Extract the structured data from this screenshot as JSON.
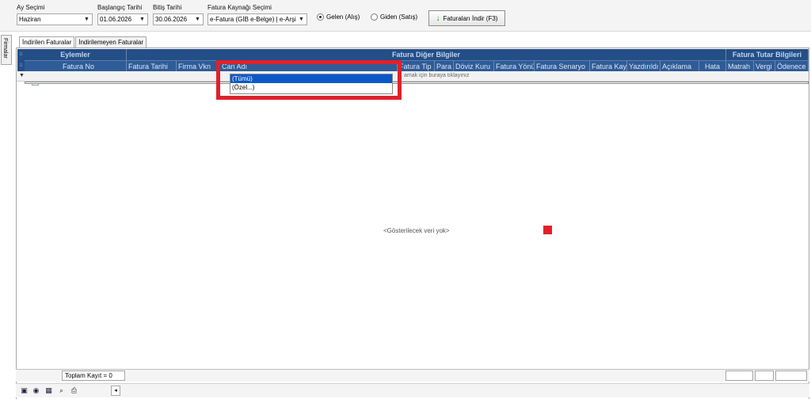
{
  "toolbar": {
    "month": {
      "label": "Ay Seçimi",
      "value": "Haziran"
    },
    "start": {
      "label": "Başlangıç Tarihi",
      "value": "01.06.2026"
    },
    "end": {
      "label": "Bitiş Tarihi",
      "value": "30.06.2026"
    },
    "source": {
      "label": "Fatura Kaynağı Seçimi",
      "value": "e-Fatura (GİB e-Belge) | e-Arşi"
    },
    "incoming_label": "Gelen (Alış)",
    "outgoing_label": "Giden (Satış)",
    "download_label": "Faturaları İndir (F3)"
  },
  "sidebar": {
    "label": "Firmalar"
  },
  "tabs": [
    {
      "label": "İndirilen Faturalar",
      "active": true
    },
    {
      "label": "İndirilemeyen Faturalar",
      "active": false
    }
  ],
  "grid": {
    "bands": [
      "Eylemler",
      "Fatura Diğer Bilgiler",
      "Fatura Tutar Bilgileri"
    ],
    "columns": [
      "Fatura No",
      "Fatura Tarihi",
      "Firma Vkn",
      "Cari Adı",
      "Fatura Tip",
      "Para",
      "Döviz Kuru",
      "Fatura Yönü",
      "Fatura Senaryo",
      "Fatura Kay",
      "Yazdırıldı",
      "Açıklama",
      "Hata",
      "Matrah",
      "Vergi",
      "Ödenece"
    ],
    "filter_hint": "amak için buraya tıklayınız",
    "empty_text": "<Gösterilecek veri yok>"
  },
  "dropdown": {
    "items": [
      "(Tümü)",
      "(Özel...)"
    ]
  },
  "status": {
    "total": "Toplam Kayıt = 0"
  },
  "colors": {
    "header_band": "#244e86",
    "header_col": "#2f5c97",
    "highlight": "#e0212a",
    "selection": "#0a58c8"
  }
}
